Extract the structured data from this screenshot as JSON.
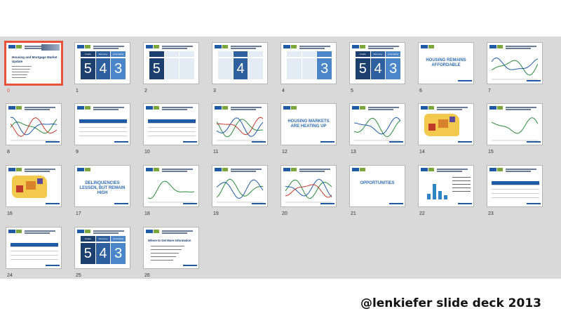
{
  "caption": "@lenkiefer slide deck 2013",
  "colors": {
    "selected": "#e8523a",
    "brand": "#1f5aa6",
    "panel": "#d9d9d9"
  },
  "slides": [
    {
      "num": "0",
      "kind": "title",
      "selected": true,
      "title_lines": [
        "Housing and Mortgage Market",
        "Update"
      ]
    },
    {
      "num": "1",
      "kind": "five43",
      "headers": [
        "Create",
        "Recovery",
        "Uncertainty"
      ],
      "digits": [
        "5",
        "4",
        "3"
      ]
    },
    {
      "num": "2",
      "kind": "five43a",
      "digits": [
        "5",
        "",
        ""
      ]
    },
    {
      "num": "3",
      "kind": "five43b",
      "digits": [
        "",
        "4",
        ""
      ]
    },
    {
      "num": "4",
      "kind": "five43c",
      "digits": [
        "",
        "",
        "3"
      ]
    },
    {
      "num": "5",
      "kind": "five43",
      "headers": [
        "Create",
        "Recovery",
        "Uncertainty"
      ],
      "digits": [
        "5",
        "4",
        "3"
      ]
    },
    {
      "num": "6",
      "kind": "section",
      "title": "HOUSING REMAINS AFFORDABLE"
    },
    {
      "num": "7",
      "kind": "chart"
    },
    {
      "num": "8",
      "kind": "chart"
    },
    {
      "num": "9",
      "kind": "table"
    },
    {
      "num": "10",
      "kind": "table"
    },
    {
      "num": "11",
      "kind": "chart"
    },
    {
      "num": "12",
      "kind": "section",
      "title": "HOUSING MARKETS ARE HEATING UP"
    },
    {
      "num": "13",
      "kind": "chart"
    },
    {
      "num": "14",
      "kind": "map"
    },
    {
      "num": "15",
      "kind": "chart"
    },
    {
      "num": "16",
      "kind": "map"
    },
    {
      "num": "17",
      "kind": "section",
      "title": "DELINQUENCIES LESSEN, BUT REMAIN HIGH"
    },
    {
      "num": "18",
      "kind": "chart"
    },
    {
      "num": "19",
      "kind": "chart"
    },
    {
      "num": "20",
      "kind": "chart"
    },
    {
      "num": "21",
      "kind": "section",
      "title": "OPPORTUNITIES"
    },
    {
      "num": "22",
      "kind": "bars"
    },
    {
      "num": "23",
      "kind": "table"
    },
    {
      "num": "24",
      "kind": "table"
    },
    {
      "num": "25",
      "kind": "five43",
      "headers": [
        "Create",
        "Recovery",
        "Uncertainty"
      ],
      "digits": [
        "5",
        "4",
        "3"
      ]
    },
    {
      "num": "26",
      "kind": "info",
      "title": "Where to Get More Information"
    }
  ]
}
